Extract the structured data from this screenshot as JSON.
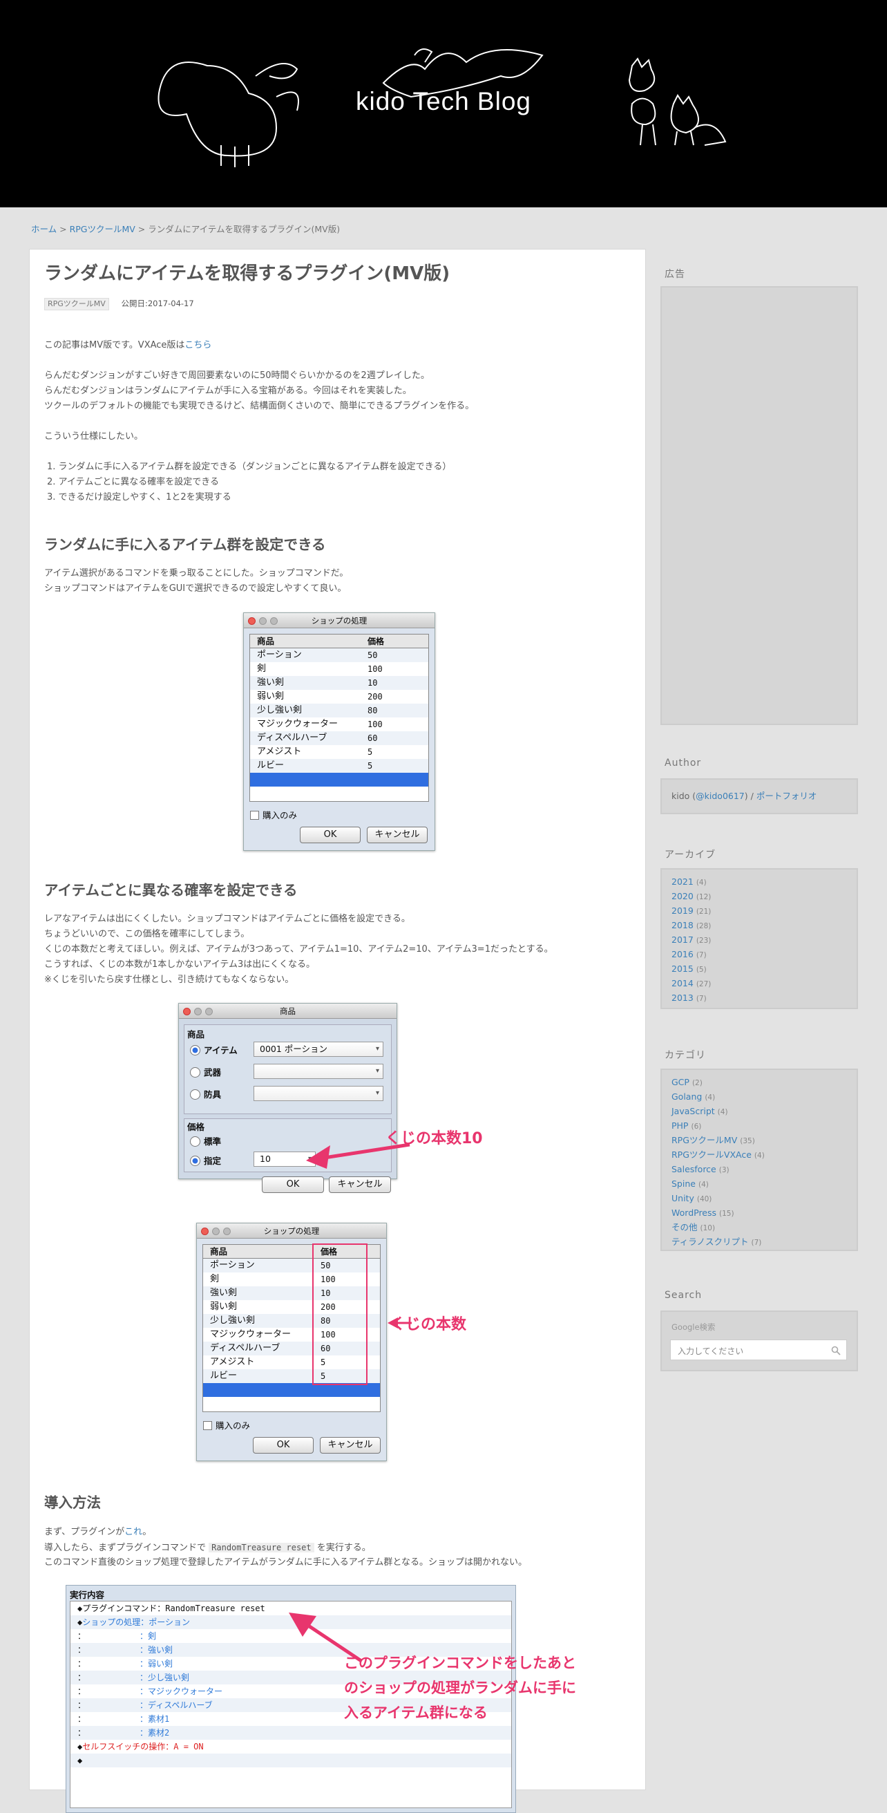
{
  "header": {
    "site_title": "kido Tech Blog"
  },
  "breadcrumb": {
    "home": "ホーム",
    "sep1": " > ",
    "category": "RPGツクールMV",
    "sep2": " > ",
    "current": "ランダムにアイテムを取得するプラグイン(MV版)"
  },
  "article": {
    "title": "ランダムにアイテムを取得するプラグイン(MV版)",
    "tag": "RPGツクールMV",
    "published": "公開日:2017-04-17",
    "intro_a": "この記事はMV版です。VXAce版は",
    "intro_link": "こちら",
    "p1": "らんだむダンジョンがすごい好きで周回要素ないのに50時間ぐらいかかるのを2週プレイした。",
    "p2": "らんだむダンジョンはランダムにアイテムが手に入る宝箱がある。今回はそれを実装した。",
    "p3": "ツクールのデフォルトの機能でも実現できるけど、結構面倒くさいので、簡単にできるプラグインを作る。",
    "p4": "こういう仕様にしたい。",
    "list": [
      "1. ランダムに手に入るアイテム群を設定できる（ダンジョンごとに異なるアイテム群を設定できる）",
      "2. アイテムごとに異なる確率を設定できる",
      "3. できるだけ設定しやすく、1と2を実現する"
    ],
    "h2_1": "ランダムに手に入るアイテム群を設定できる",
    "s1a": "アイテム選択があるコマンドを乗っ取ることにした。ショップコマンドだ。",
    "s1b": "ショップコマンドはアイテムをGUIで選択できるので設定しやすくて良い。",
    "h2_2": "アイテムごとに異なる確率を設定できる",
    "s2": [
      "レアなアイテムは出にくくしたい。ショップコマンドはアイテムごとに価格を設定できる。",
      "ちょうどいいので、この価格を確率にしてしまう。",
      "くじの本数だと考えてほしい。例えば、アイテムが3つあって、アイテム1=10、アイテム2=10、アイテム3=1だったとする。",
      "こうすれば、くじの本数が1本しかないアイテム3は出にくくなる。",
      "※くじを引いたら戻す仕様とし、引き続けてもなくならない。"
    ],
    "h2_3": "導入方法",
    "s3a": "まず、プラグインが",
    "s3a_link": "これ",
    "s3a_end": "。",
    "s3b_pre": "導入したら、まずプラグインコマンドで ",
    "s3b_code": "RandomTreasure reset",
    "s3b_post": " を実行する。",
    "s3c": "このコマンド直後のショップ処理で登録したアイテムがランダムに手に入るアイテム群となる。ショップは開かれない。"
  },
  "shop_dialog": {
    "title": "ショップの処理",
    "col_item": "商品",
    "col_price": "価格",
    "rows": [
      [
        "ポーション",
        "50"
      ],
      [
        "剣",
        "100"
      ],
      [
        "強い剣",
        "10"
      ],
      [
        "弱い剣",
        "200"
      ],
      [
        "少し強い剣",
        "80"
      ],
      [
        "マジックウォーター",
        "100"
      ],
      [
        "ディスペルハーブ",
        "60"
      ],
      [
        "アメジスト",
        "5"
      ],
      [
        "ルビー",
        "5"
      ]
    ],
    "buy_only": "購入のみ",
    "ok": "OK",
    "cancel": "キャンセル"
  },
  "item_dialog": {
    "title": "商品",
    "sec_item": "商品",
    "item": "アイテム",
    "item_value": "0001 ポーション",
    "weapon": "武器",
    "armor": "防具",
    "sec_price": "価格",
    "standard": "標準",
    "specify": "指定",
    "price_value": "10",
    "ok": "OK",
    "cancel": "キャンセル"
  },
  "annotations": {
    "a1": "くじの本数10",
    "a2": "くじの本数",
    "a3": [
      "このプラグインコマンドをしたあと",
      "のショップの処理がランダムに手に",
      "入るアイテム群になる"
    ]
  },
  "command_list": {
    "header": "実行内容",
    "lines": [
      {
        "p": "◆",
        "k": "プラグインコマンド：",
        "v": "RandomTreasure reset",
        "c": "plain"
      },
      {
        "p": "◆",
        "k": "ショップの処理：",
        "v": "ポーション",
        "c": "blu"
      },
      {
        "p": "：",
        "k": "　　　　　　　：",
        "v": "剣",
        "c": "blu"
      },
      {
        "p": "：",
        "k": "　　　　　　　：",
        "v": "強い剣",
        "c": "blu"
      },
      {
        "p": "：",
        "k": "　　　　　　　：",
        "v": "弱い剣",
        "c": "blu"
      },
      {
        "p": "：",
        "k": "　　　　　　　：",
        "v": "少し強い剣",
        "c": "blu"
      },
      {
        "p": "：",
        "k": "　　　　　　　：",
        "v": "マジックウォーター",
        "c": "blu"
      },
      {
        "p": "：",
        "k": "　　　　　　　：",
        "v": "ディスペルハーブ",
        "c": "blu"
      },
      {
        "p": "：",
        "k": "　　　　　　　：",
        "v": "素材1",
        "c": "blu"
      },
      {
        "p": "：",
        "k": "　　　　　　　：",
        "v": "素材2",
        "c": "blu"
      },
      {
        "p": "◆",
        "k": "セルフスイッチの操作：",
        "v": "A = ON",
        "c": "red"
      },
      {
        "p": "◆",
        "k": "",
        "v": "",
        "c": "plain"
      }
    ]
  },
  "sidebar": {
    "ad_heading": "広告",
    "author_heading": "Author",
    "author_name": "kido (",
    "author_handle": "@kido0617",
    "author_sep": ") / ",
    "author_portfolio": "ポートフォリオ",
    "archive_heading": "アーカイブ",
    "archives": [
      [
        "2021",
        "(4)"
      ],
      [
        "2020",
        "(12)"
      ],
      [
        "2019",
        "(21)"
      ],
      [
        "2018",
        "(28)"
      ],
      [
        "2017",
        "(23)"
      ],
      [
        "2016",
        "(7)"
      ],
      [
        "2015",
        "(5)"
      ],
      [
        "2014",
        "(27)"
      ],
      [
        "2013",
        "(7)"
      ]
    ],
    "category_heading": "カテゴリ",
    "categories": [
      [
        "GCP",
        "(2)"
      ],
      [
        "Golang",
        "(4)"
      ],
      [
        "JavaScript",
        "(4)"
      ],
      [
        "PHP",
        "(6)"
      ],
      [
        "RPGツクールMV",
        "(35)"
      ],
      [
        "RPGツクールVXAce",
        "(4)"
      ],
      [
        "Salesforce",
        "(3)"
      ],
      [
        "Spine",
        "(4)"
      ],
      [
        "Unity",
        "(40)"
      ],
      [
        "WordPress",
        "(15)"
      ],
      [
        "その他",
        "(10)"
      ],
      [
        "ティラノスクリプト",
        "(7)"
      ]
    ],
    "search_heading": "Search",
    "google_label": "Google検索",
    "search_placeholder": "入力してください"
  },
  "colors": {
    "header_bg": "#000000",
    "link": "#3a7fb8",
    "annotation": "#e8356d",
    "selection": "#2f6ee0"
  }
}
